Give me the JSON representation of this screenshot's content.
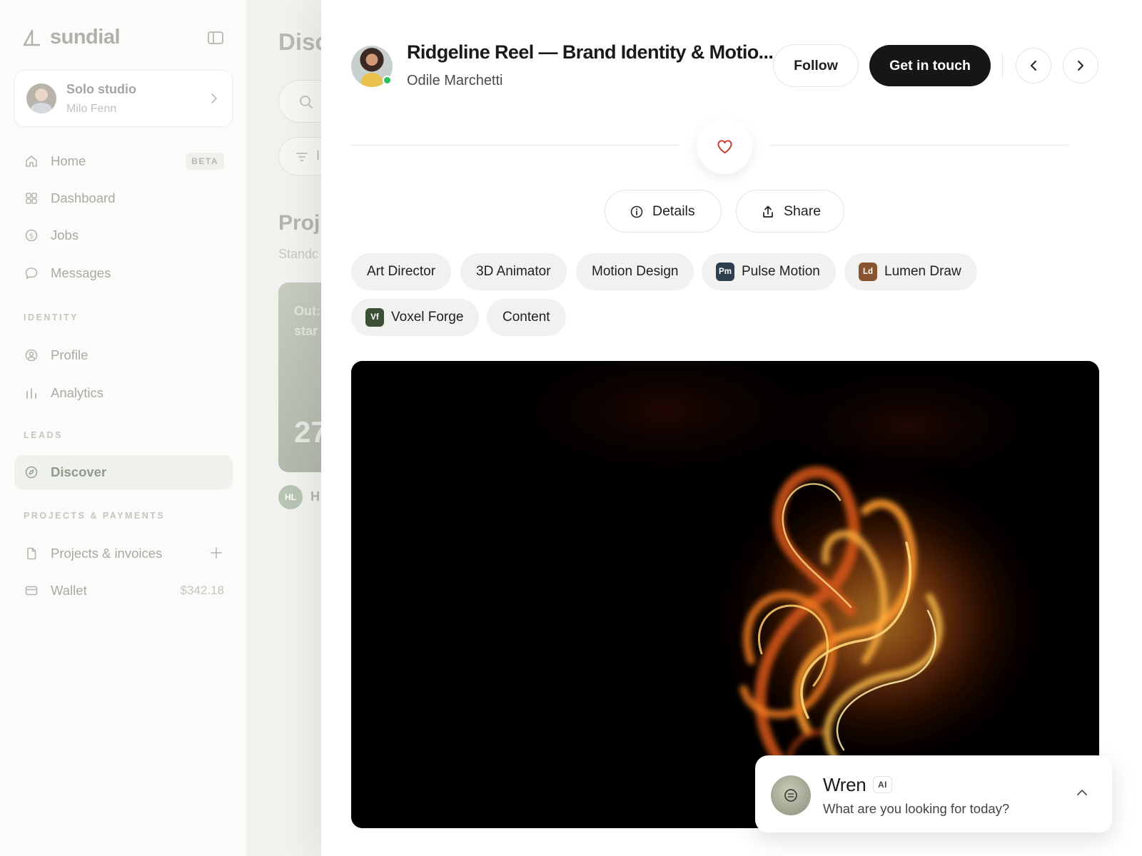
{
  "brand": {
    "name": "sundial"
  },
  "studio": {
    "name": "Solo studio",
    "owner": "Milo Fenn"
  },
  "nav": {
    "home": {
      "label": "Home",
      "badge": "BETA"
    },
    "dashboard": {
      "label": "Dashboard"
    },
    "jobs": {
      "label": "Jobs"
    },
    "messages": {
      "label": "Messages"
    },
    "identity_section": "IDENTITY",
    "profile": {
      "label": "Profile"
    },
    "analytics": {
      "label": "Analytics"
    },
    "leads_section": "LEADS",
    "discover": {
      "label": "Discover"
    },
    "payments_section": "PROJECTS & PAYMENTS",
    "projects": {
      "label": "Projects & invoices"
    },
    "wallet": {
      "label": "Wallet",
      "amount": "$342.18"
    }
  },
  "background": {
    "title": "Disc",
    "filter": "I",
    "section_title": "Proj",
    "section_sub": "Standc",
    "card_text": [
      "Out:",
      "star"
    ],
    "card_number": "27",
    "creator_initials": "HL",
    "creator_name": "H"
  },
  "project": {
    "title": "Ridgeline Reel — Brand Identity & Motio...",
    "author": "Odile Marchetti",
    "follow_label": "Follow",
    "contact_label": "Get in touch",
    "details_label": "Details",
    "share_label": "Share",
    "tags": [
      {
        "label": "Art Director"
      },
      {
        "label": "3D Animator"
      },
      {
        "label": "Motion Design"
      },
      {
        "label": "Pulse Motion",
        "icon_text": "Pm",
        "icon_color": "#2f3f4f"
      },
      {
        "label": "Lumen Draw",
        "icon_text": "Ld",
        "icon_color": "#8a5430"
      },
      {
        "label": "Voxel Forge",
        "icon_text": "Vf",
        "icon_color": "#3b4f35"
      },
      {
        "label": "Content"
      }
    ]
  },
  "assistant": {
    "name": "Wren",
    "badge": "AI",
    "prompt": "What are you looking for today?"
  },
  "colors": {
    "accent": "#161616",
    "online": "#2dbf5f",
    "heart": "#c8473c"
  }
}
